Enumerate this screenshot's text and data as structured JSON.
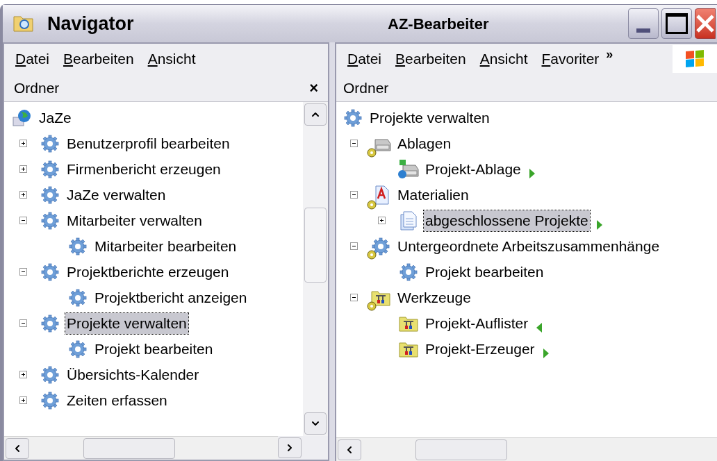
{
  "title_bar": {
    "left_title": "Navigator",
    "right_title": "AZ-Bearbeiter"
  },
  "left_pane": {
    "menu": [
      "Datei",
      "Bearbeiten",
      "Ansicht"
    ],
    "header": "Ordner",
    "close": "×",
    "tree": [
      {
        "label": "JaZe",
        "kind": "globe",
        "selected": false,
        "children": [
          {
            "label": "Benutzerprofil bearbeiten",
            "kind": "gear",
            "expanded": false,
            "selected": false
          },
          {
            "label": "Firmenbericht erzeugen",
            "kind": "gear",
            "expanded": false,
            "selected": false
          },
          {
            "label": "JaZe verwalten",
            "kind": "gear",
            "expanded": false,
            "selected": false
          },
          {
            "label": "Mitarbeiter verwalten",
            "kind": "gear",
            "expanded": true,
            "selected": false,
            "children": [
              {
                "label": "Mitarbeiter bearbeiten",
                "kind": "gear",
                "selected": false
              }
            ]
          },
          {
            "label": "Projektberichte erzeugen",
            "kind": "gear",
            "expanded": true,
            "selected": false,
            "children": [
              {
                "label": "Projektbericht anzeigen",
                "kind": "gear",
                "selected": false
              }
            ]
          },
          {
            "label": "Projekte verwalten",
            "kind": "gear",
            "expanded": true,
            "selected": true,
            "children": [
              {
                "label": "Projekt bearbeiten",
                "kind": "gear",
                "selected": false
              }
            ]
          },
          {
            "label": "Übersichts-Kalender",
            "kind": "gear",
            "expanded": false,
            "selected": false
          },
          {
            "label": "Zeiten erfassen",
            "kind": "gear",
            "expanded": false,
            "selected": false
          }
        ]
      }
    ]
  },
  "right_pane": {
    "menu": [
      "Datei",
      "Bearbeiten",
      "Ansicht",
      "Favoriter"
    ],
    "overflow": "»",
    "header": "Ordner",
    "tree": [
      {
        "label": "Projekte verwalten",
        "kind": "gear",
        "selected": false,
        "children": [
          {
            "label": "Ablagen",
            "kind": "drive",
            "badge": true,
            "expanded": true,
            "selected": false,
            "children": [
              {
                "label": "Projekt-Ablage",
                "kind": "drive-globe",
                "selected": false,
                "arrow": {
                  "kind": "right"
                }
              }
            ]
          },
          {
            "label": "Materialien",
            "kind": "letter",
            "badge": true,
            "expanded": true,
            "selected": false,
            "children": [
              {
                "label": "abgeschlossene Projekte",
                "kind": "document",
                "expanded": false,
                "selected": true,
                "arrow": {
                  "kind": "right"
                }
              }
            ]
          },
          {
            "label": "Untergeordnete Arbeitszusammenhänge",
            "kind": "gear",
            "badge": true,
            "expanded": true,
            "selected": false,
            "children": [
              {
                "label": "Projekt bearbeiten",
                "kind": "gear",
                "selected": false
              }
            ]
          },
          {
            "label": "Werkzeuge",
            "kind": "tools",
            "badge": true,
            "expanded": true,
            "selected": false,
            "children": [
              {
                "label": "Projekt-Auflister",
                "kind": "tools",
                "selected": false,
                "arrow": {
                  "kind": "left"
                }
              },
              {
                "label": "Projekt-Erzeuger",
                "kind": "tools",
                "selected": false,
                "arrow": {
                  "kind": "right"
                }
              }
            ]
          }
        ]
      }
    ]
  }
}
